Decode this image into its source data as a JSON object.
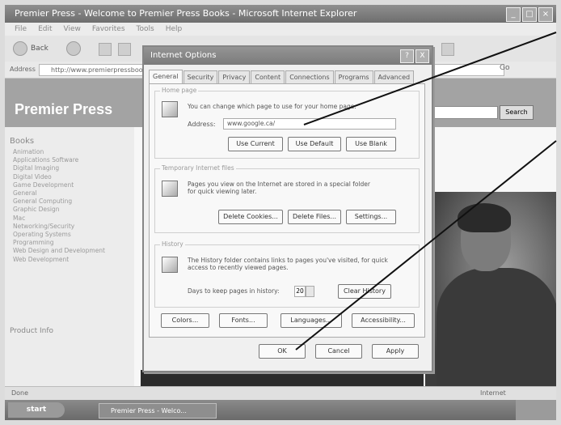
{
  "window": {
    "title": "Premier Press - Welcome to Premier Press Books - Microsoft Internet Explorer",
    "menu": [
      "File",
      "Edit",
      "View",
      "Favorites",
      "Tools",
      "Help"
    ],
    "back_label": "Back",
    "address_label": "Address",
    "address_value": "http://www.premierpressbooks.com",
    "go_label": "Go"
  },
  "webpage": {
    "brand": "Premier Press",
    "search_button": "Search",
    "nav_heading": "Books",
    "nav_items": [
      "Animation",
      "Applications Software",
      "Digital Imaging",
      "Digital Video",
      "Game Development",
      "General",
      "General Computing",
      "Graphic Design",
      "Mac",
      "Networking/Security",
      "Operating Systems",
      "Programming",
      "Web Design and Development",
      "Web Development"
    ],
    "nav_footer": "Product Info"
  },
  "status": {
    "left": "Done",
    "right": "Internet"
  },
  "taskbar": {
    "start": "start",
    "task": "Premier Press - Welco..."
  },
  "dialog": {
    "title": "Internet Options",
    "help_icon": "?",
    "close_icon": "X",
    "tabs": [
      "General",
      "Security",
      "Privacy",
      "Content",
      "Connections",
      "Programs",
      "Advanced"
    ],
    "home": {
      "title": "Home page",
      "text": "You can change which page to use for your home page.",
      "address_label": "Address:",
      "address_value": "www.google.ca/",
      "btn_current": "Use Current",
      "btn_default": "Use Default",
      "btn_blank": "Use Blank"
    },
    "temp": {
      "title": "Temporary Internet files",
      "text": "Pages you view on the Internet are stored in a special folder for quick viewing later.",
      "btn_cookies": "Delete Cookies...",
      "btn_files": "Delete Files...",
      "btn_settings": "Settings..."
    },
    "history": {
      "title": "History",
      "text": "The History folder contains links to pages you've visited, for quick access to recently viewed pages.",
      "days_label": "Days to keep pages in history:",
      "days_value": "20",
      "btn_clear": "Clear History"
    },
    "bottom": {
      "btn_colors": "Colors...",
      "btn_fonts": "Fonts...",
      "btn_languages": "Languages...",
      "btn_accessibility": "Accessibility..."
    },
    "footer": {
      "ok": "OK",
      "cancel": "Cancel",
      "apply": "Apply"
    }
  }
}
